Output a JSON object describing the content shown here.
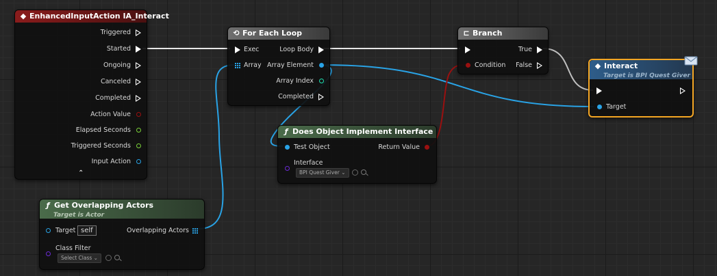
{
  "nodes": {
    "event": {
      "title": "EnhancedInputAction IA_Interact",
      "pins": [
        "Triggered",
        "Started",
        "Ongoing",
        "Canceled",
        "Completed",
        "Action Value",
        "Elapsed Seconds",
        "Triggered Seconds",
        "Input Action"
      ],
      "collapse": "⌃"
    },
    "foreach": {
      "title": "For Each Loop",
      "in_exec": "Exec",
      "in_array": "Array",
      "out_body": "Loop Body",
      "out_elem": "Array Element",
      "out_index": "Array Index",
      "out_done": "Completed"
    },
    "branch": {
      "title": "Branch",
      "in_cond": "Condition",
      "out_true": "True",
      "out_false": "False"
    },
    "interact": {
      "title": "Interact",
      "subtitle": "Target is BPI Quest Giver",
      "in_target": "Target"
    },
    "implements": {
      "title": "Does Object Implement Interface",
      "in_obj": "Test Object",
      "out_ret": "Return Value",
      "in_iface": "Interface",
      "iface_value": "BPI Quest Giver"
    },
    "overlap": {
      "title": "Get Overlapping Actors",
      "subtitle": "Target is Actor",
      "in_target": "Target",
      "target_value": "self",
      "out_actors": "Overlapping Actors",
      "in_filter": "Class Filter",
      "filter_value": "Select Class"
    }
  },
  "colors": {
    "exec": "#ffffff",
    "object": "#29a3e6",
    "bool": "#9a1010",
    "int": "#1fe0b0",
    "float": "#7bd13a",
    "class": "#6b2bd6",
    "event_header": "#8a1c1c",
    "func_header": "#3f5a3f",
    "selected": "#f5a623"
  }
}
